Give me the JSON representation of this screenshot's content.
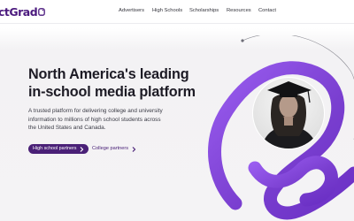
{
  "brand": {
    "logo_text": "ctGrad",
    "accent": "#4a2077",
    "swirl_color": "#7a3fd0"
  },
  "nav": {
    "items": [
      {
        "label": "Advertisers"
      },
      {
        "label": "High Schools"
      },
      {
        "label": "Scholarships"
      },
      {
        "label": "Resources"
      },
      {
        "label": "Contact"
      }
    ]
  },
  "hero": {
    "title_line_1": "North America's leading",
    "title_line_2": "in-school media platform",
    "desc_line_1": "A trusted platform for delivering college and university",
    "desc_line_2": "information to millions of high school students across",
    "desc_line_3": "the United States and Canada.",
    "primary_button": "High school partners",
    "secondary_button": "College partners"
  },
  "icons": {
    "logo_mark": "logo-mark-icon",
    "primary_chevron": "chevron-right-icon",
    "secondary_chevron": "chevron-right-icon"
  }
}
